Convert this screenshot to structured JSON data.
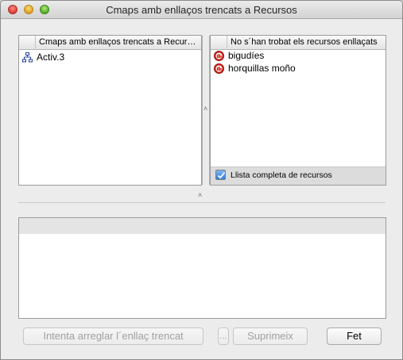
{
  "window": {
    "title": "Cmaps amb enllaços trencats a Recursos"
  },
  "left_panel": {
    "header": "Cmaps amb enllaços trencats a Recursos",
    "items": [
      {
        "label": "Activ.3",
        "icon": "cmap-icon"
      }
    ]
  },
  "right_panel": {
    "header": "No s´han trobat els recursos enllaçats",
    "items": [
      {
        "label": "bigudíes",
        "icon": "broken-resource-icon"
      },
      {
        "label": "horquillas moño",
        "icon": "broken-resource-icon"
      }
    ],
    "full_list_checkbox": {
      "label": "Llista completa de recursos",
      "checked": true
    }
  },
  "bottom_panel": {
    "header": ""
  },
  "buttons": {
    "fix_label": "Intenta arreglar l´enllaç trencat",
    "more_label": "...",
    "delete_label": "Suprimeix",
    "done_label": "Fet"
  },
  "colors": {
    "accent": "#2f7ce0",
    "broken_icon": "#d4261c"
  }
}
